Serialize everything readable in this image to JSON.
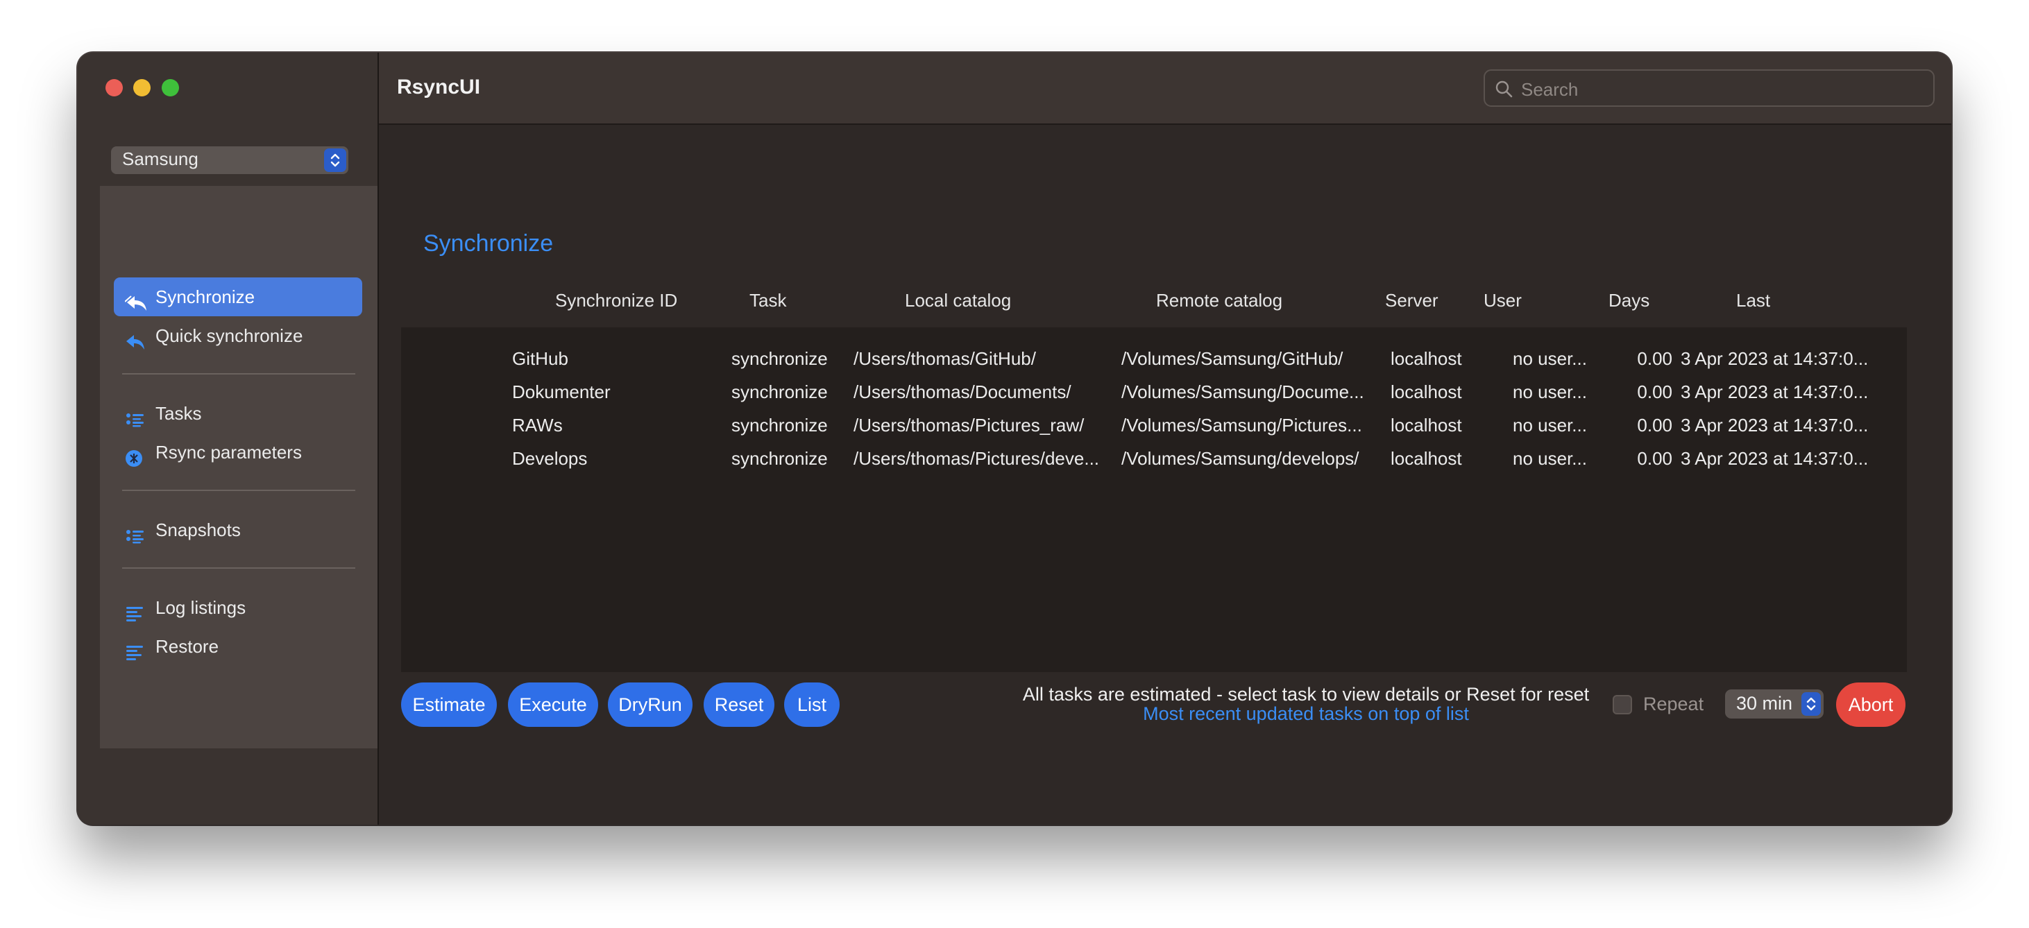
{
  "app": {
    "title": "RsyncUI"
  },
  "search": {
    "placeholder": "Search"
  },
  "profile": {
    "selected": "Samsung"
  },
  "sidebar": {
    "items": [
      {
        "label": "Synchronize",
        "icon": "arrows-sync-icon",
        "active": true
      },
      {
        "label": "Quick synchronize",
        "icon": "arrow-back-icon"
      },
      {
        "label": "Tasks",
        "icon": "task-list-icon"
      },
      {
        "label": "Rsync parameters",
        "icon": "rsync-parameters-icon"
      },
      {
        "label": "Snapshots",
        "icon": "snapshot-list-icon"
      },
      {
        "label": "Log listings",
        "icon": "lines-icon"
      },
      {
        "label": "Restore",
        "icon": "lines-icon"
      }
    ]
  },
  "main": {
    "section_title": "Synchronize",
    "columns": [
      "Synchronize ID",
      "Task",
      "Local catalog",
      "Remote catalog",
      "Server",
      "User",
      "Days",
      "Last"
    ],
    "rows": [
      [
        "GitHub",
        "synchronize",
        "/Users/thomas/GitHub/",
        "/Volumes/Samsung/GitHub/",
        "localhost",
        "no user...",
        "0.00",
        "3 Apr 2023 at 14:37:0..."
      ],
      [
        "Dokumenter",
        "synchronize",
        "/Users/thomas/Documents/",
        "/Volumes/Samsung/Docume...",
        "localhost",
        "no user...",
        "0.00",
        "3 Apr 2023 at 14:37:0..."
      ],
      [
        "RAWs",
        "synchronize",
        "/Users/thomas/Pictures_raw/",
        "/Volumes/Samsung/Pictures...",
        "localhost",
        "no user...",
        "0.00",
        "3 Apr 2023 at 14:37:0..."
      ],
      [
        "Develops",
        "synchronize",
        "/Users/thomas/Pictures/deve...",
        "/Volumes/Samsung/develops/",
        "localhost",
        "no user...",
        "0.00",
        "3 Apr 2023 at 14:37:0..."
      ]
    ]
  },
  "toolbar": {
    "estimate": "Estimate",
    "execute": "Execute",
    "dryrun": "DryRun",
    "reset": "Reset",
    "list": "List",
    "status_main": "All tasks are estimated - select task to view details or Reset for reset",
    "status_sub": "Most recent updated tasks on top of list",
    "repeat": "Repeat",
    "interval": "30 min",
    "abort": "Abort"
  },
  "colors": {
    "accent": "#2f6fe8",
    "link": "#3b8ef5",
    "abort": "#e5473e"
  }
}
